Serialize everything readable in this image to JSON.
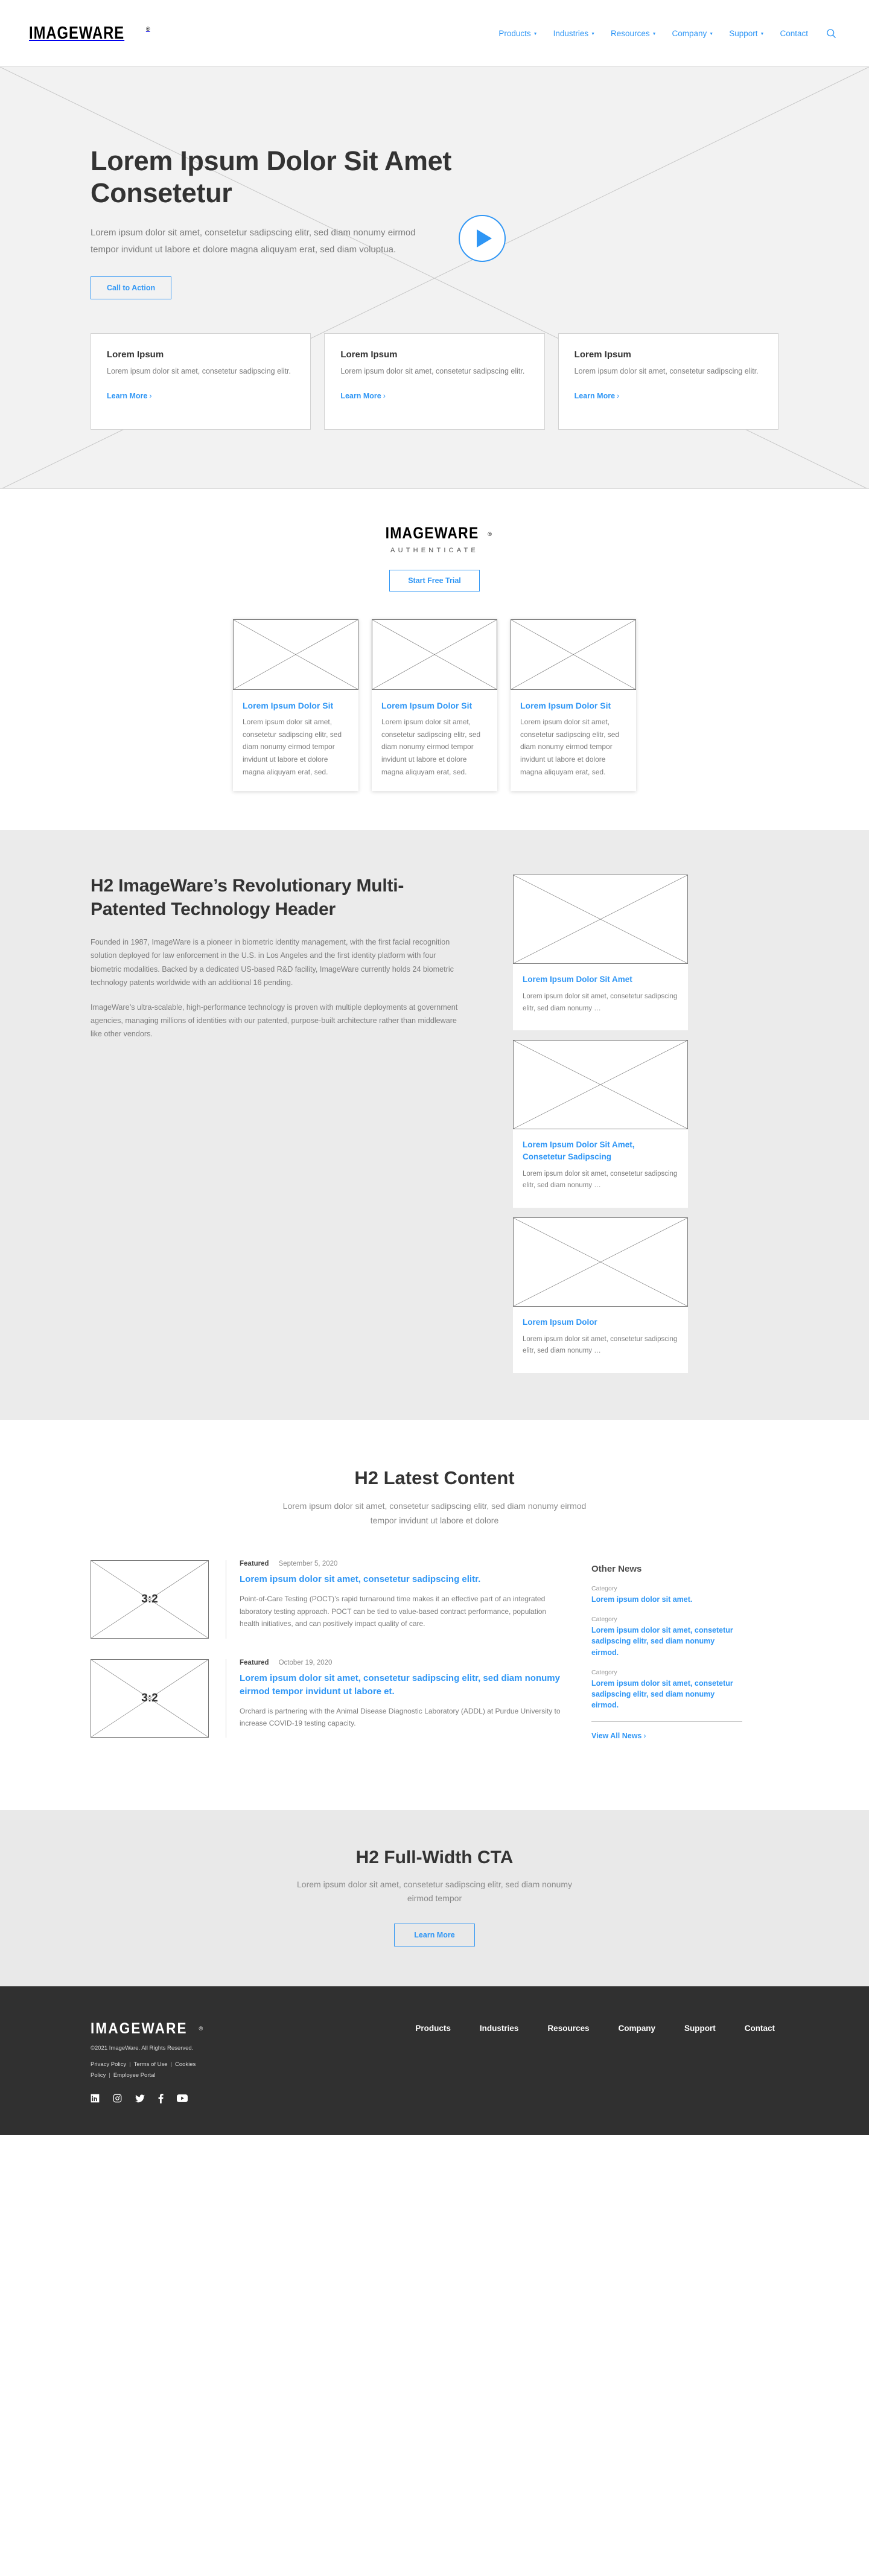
{
  "brand": {
    "name": "IMAGEWARE",
    "registered": "®",
    "accent_color": "#2f96f5",
    "dark_color": "#303030"
  },
  "header": {
    "nav": [
      {
        "label": "Products",
        "has_caret": true
      },
      {
        "label": "Industries",
        "has_caret": true
      },
      {
        "label": "Resources",
        "has_caret": true
      },
      {
        "label": "Company",
        "has_caret": true
      },
      {
        "label": "Support",
        "has_caret": true
      },
      {
        "label": "Contact",
        "has_caret": false
      }
    ],
    "search_icon": "search-icon"
  },
  "hero": {
    "title": "Lorem Ipsum Dolor Sit Amet Consetetur",
    "subtitle": "Lorem ipsum dolor sit amet, consetetur sadipscing elitr, sed diam nonumy eirmod tempor invidunt ut labore et dolore magna aliquyam erat, sed diam voluptua.",
    "cta_label": "Call to Action",
    "play_icon": "play-icon",
    "cards": [
      {
        "title": "Lorem Ipsum",
        "body": "Lorem ipsum dolor sit amet, consetetur sadipscing elitr.",
        "link": "Learn More",
        "chevron": "›"
      },
      {
        "title": "Lorem Ipsum",
        "body": "Lorem ipsum dolor sit amet, consetetur sadipscing elitr.",
        "link": "Learn More",
        "chevron": "›"
      },
      {
        "title": "Lorem Ipsum",
        "body": "Lorem ipsum dolor sit amet, consetetur sadipscing elitr.",
        "link": "Learn More",
        "chevron": "›"
      }
    ]
  },
  "authenticate": {
    "logo": "IMAGEWARE",
    "registered": "®",
    "product": "AUTHENTICATE",
    "button_label": "Start Free Trial",
    "cards": [
      {
        "title": "Lorem Ipsum Dolor Sit",
        "body": "Lorem ipsum dolor sit amet, consetetur sadipscing elitr, sed diam nonumy eirmod tempor invidunt ut labore et dolore magna aliquyam erat, sed."
      },
      {
        "title": "Lorem Ipsum Dolor Sit",
        "body": "Lorem ipsum dolor sit amet, consetetur sadipscing elitr, sed diam nonumy eirmod tempor invidunt ut labore et dolore magna aliquyam erat, sed."
      },
      {
        "title": "Lorem Ipsum Dolor Sit",
        "body": "Lorem ipsum dolor sit amet, consetetur sadipscing elitr, sed diam nonumy eirmod tempor invidunt ut labore et dolore magna aliquyam erat, sed."
      }
    ]
  },
  "revolutionary": {
    "heading": "H2 ImageWare’s Revolutionary Multi-Patented Technology Header",
    "paragraph1": "Founded in 1987, ImageWare is a pioneer in biometric identity management, with the first facial recognition solution deployed for law enforcement in the U.S. in Los Angeles and the first identity platform with four biometric modalities. Backed by a dedicated US-based R&D facility, ImageWare currently holds 24 biometric technology patents worldwide with an additional 16 pending.",
    "paragraph2": "ImageWare’s ultra-scalable, high-performance technology is proven with multiple deployments at government agencies, managing millions of identities with our patented, purpose-built architecture rather than middleware like other vendors.",
    "news_cards": [
      {
        "title": "Lorem Ipsum Dolor Sit Amet",
        "body": "Lorem ipsum dolor sit amet, consetetur sadipscing elitr, sed diam nonumy …"
      },
      {
        "title": "Lorem Ipsum Dolor Sit Amet, Consetetur Sadipscing",
        "body": "Lorem ipsum dolor sit amet, consetetur sadipscing elitr, sed diam nonumy …"
      },
      {
        "title": "Lorem Ipsum Dolor",
        "body": "Lorem ipsum dolor sit amet, consetetur sadipscing elitr, sed diam nonumy …"
      }
    ]
  },
  "latest": {
    "heading": "H2 Latest Content",
    "subheading": "Lorem ipsum dolor sit amet, consetetur sadipscing elitr, sed diam nonumy eirmod tempor invidunt ut labore et dolore",
    "articles": [
      {
        "thumb_label": "3:2",
        "tag": "Featured",
        "date": "September 5, 2020",
        "title": "Lorem ipsum dolor sit amet, consetetur sadipscing elitr.",
        "excerpt": "Point-of-Care Testing (POCT)’s rapid turnaround time makes it an effective part of an integrated laboratory testing approach. POCT can be tied to value-based contract performance, population health initiatives, and can positively impact quality of care."
      },
      {
        "thumb_label": "3:2",
        "tag": "Featured",
        "date": "October 19, 2020",
        "title": "Lorem ipsum dolor sit amet, consetetur sadipscing elitr, sed diam nonumy eirmod tempor invidunt ut labore et.",
        "excerpt": "Orchard is partnering with the Animal Disease Diagnostic Laboratory (ADDL) at Purdue University to increase COVID-19 testing capacity."
      }
    ],
    "other_news": {
      "heading": "Other News",
      "items": [
        {
          "category": "Category",
          "title": "Lorem ipsum dolor sit amet."
        },
        {
          "category": "Category",
          "title": "Lorem ipsum dolor sit amet, consetetur sadipscing elitr, sed diam nonumy eirmod."
        },
        {
          "category": "Category",
          "title": "Lorem ipsum dolor sit amet, consetetur sadipscing elitr, sed diam nonumy eirmod."
        }
      ],
      "view_all": "View All News",
      "chevron": "›"
    }
  },
  "cta": {
    "heading": "H2 Full-Width CTA",
    "body": "Lorem ipsum dolor sit amet, consetetur sadipscing elitr, sed diam nonumy eirmod tempor",
    "button_label": "Learn More"
  },
  "footer": {
    "logo": "IMAGEWARE",
    "registered": "®",
    "copyright": "©2021 ImageWare. All Rights Reserved.",
    "legal": [
      "Privacy Policy",
      "Terms of Use",
      "Cookies Policy",
      "Employee Portal"
    ],
    "separator": "|",
    "socials": [
      "linkedin-icon",
      "instagram-icon",
      "twitter-icon",
      "facebook-icon",
      "youtube-icon"
    ],
    "nav": [
      "Products",
      "Industries",
      "Resources",
      "Company",
      "Support",
      "Contact"
    ]
  }
}
